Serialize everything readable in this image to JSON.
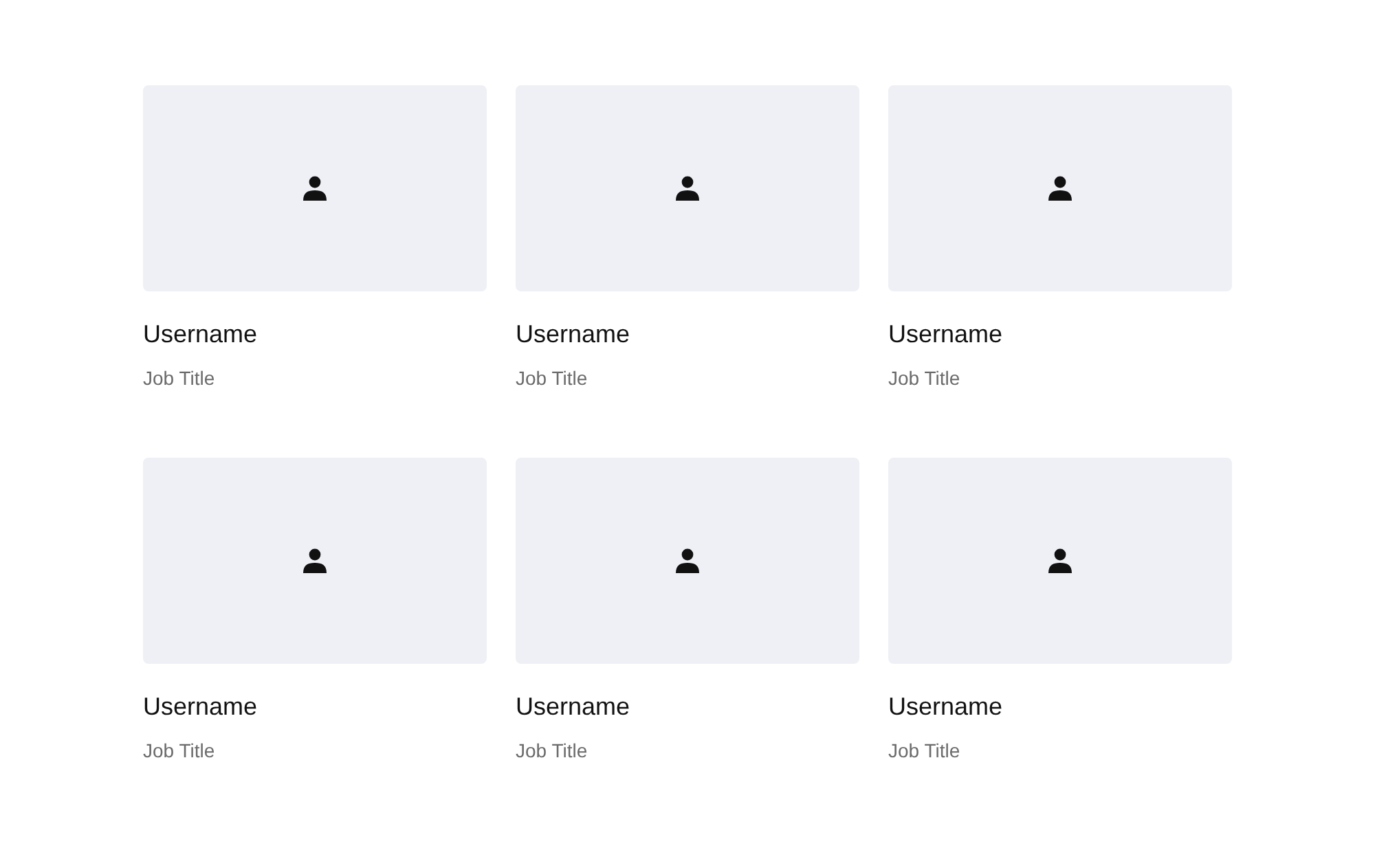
{
  "profiles": [
    {
      "username": "Username",
      "job_title": "Job Title"
    },
    {
      "username": "Username",
      "job_title": "Job Title"
    },
    {
      "username": "Username",
      "job_title": "Job Title"
    },
    {
      "username": "Username",
      "job_title": "Job Title"
    },
    {
      "username": "Username",
      "job_title": "Job Title"
    },
    {
      "username": "Username",
      "job_title": "Job Title"
    }
  ]
}
